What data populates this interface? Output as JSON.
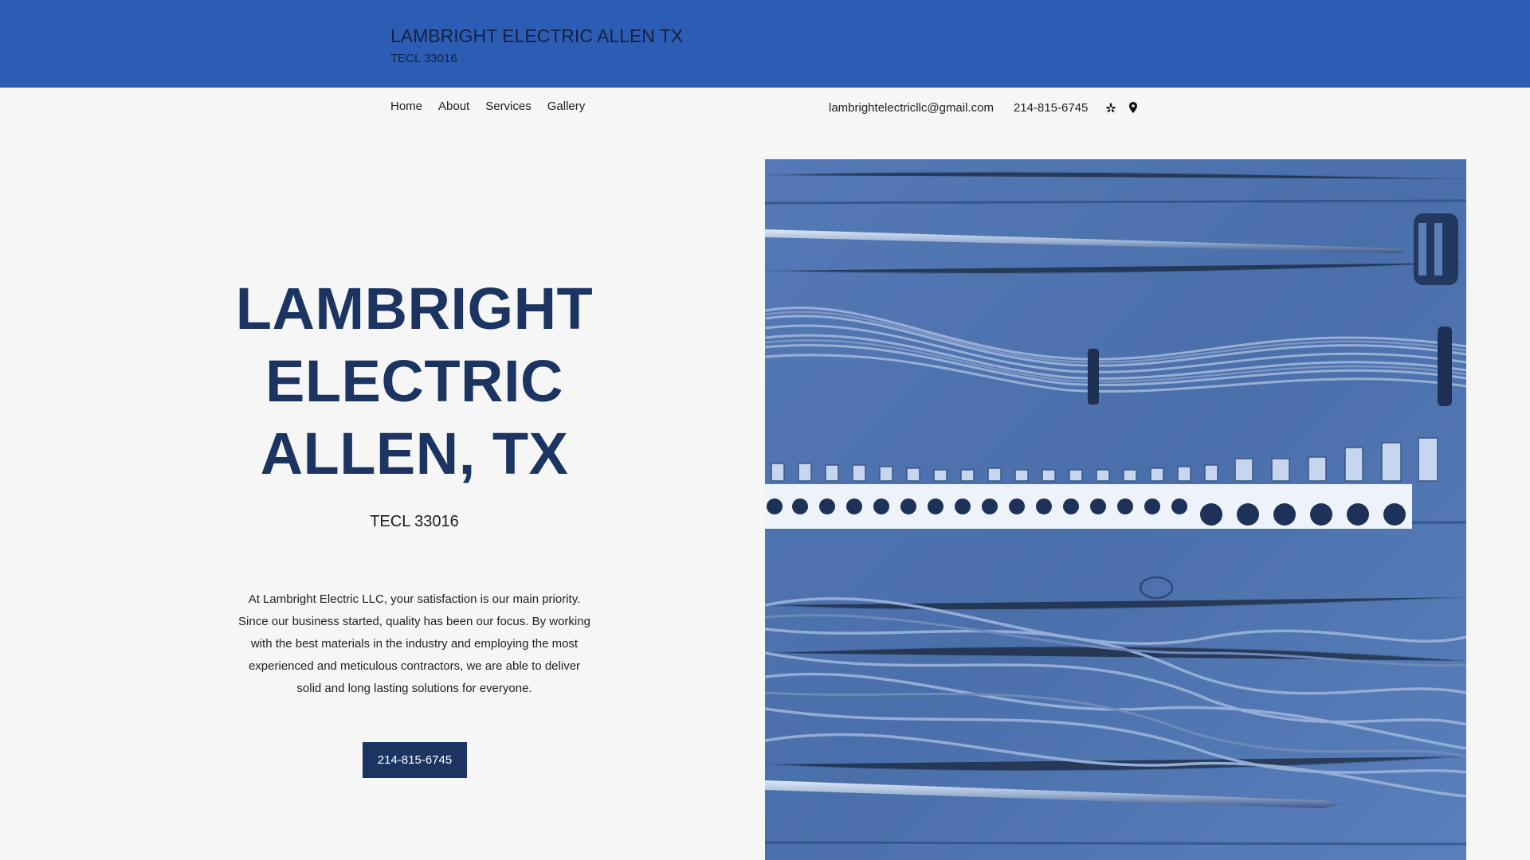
{
  "header": {
    "title": "LAMBRIGHT ELECTRIC ALLEN TX",
    "subtitle": "TECL 33016"
  },
  "nav": {
    "items": [
      {
        "label": "Home"
      },
      {
        "label": "About"
      },
      {
        "label": "Services"
      },
      {
        "label": "Gallery"
      }
    ]
  },
  "contact": {
    "email": "lambrightelectricllc@gmail.com",
    "phone": "214-815-6745",
    "icons": [
      "yelp-icon",
      "map-pin-icon"
    ]
  },
  "hero": {
    "title_lines": [
      "LAMBRIGHT",
      "ELECTRIC",
      "ALLEN, TX"
    ],
    "subtitle": "TECL 33016",
    "body_lines": [
      "At Lambright Electric LLC, your satisfaction is our main priority.",
      "Since our business started, quality has been our focus. By working",
      "with the best materials in the industry and employing the most",
      "experienced and meticulous contractors, we are able to deliver",
      "solid and long lasting solutions for everyone."
    ],
    "cta_label": "214-815-6745"
  },
  "colors": {
    "header_bg": "#2c5db5",
    "accent_dark": "#1b3461",
    "page_bg": "#f6f6f6"
  }
}
